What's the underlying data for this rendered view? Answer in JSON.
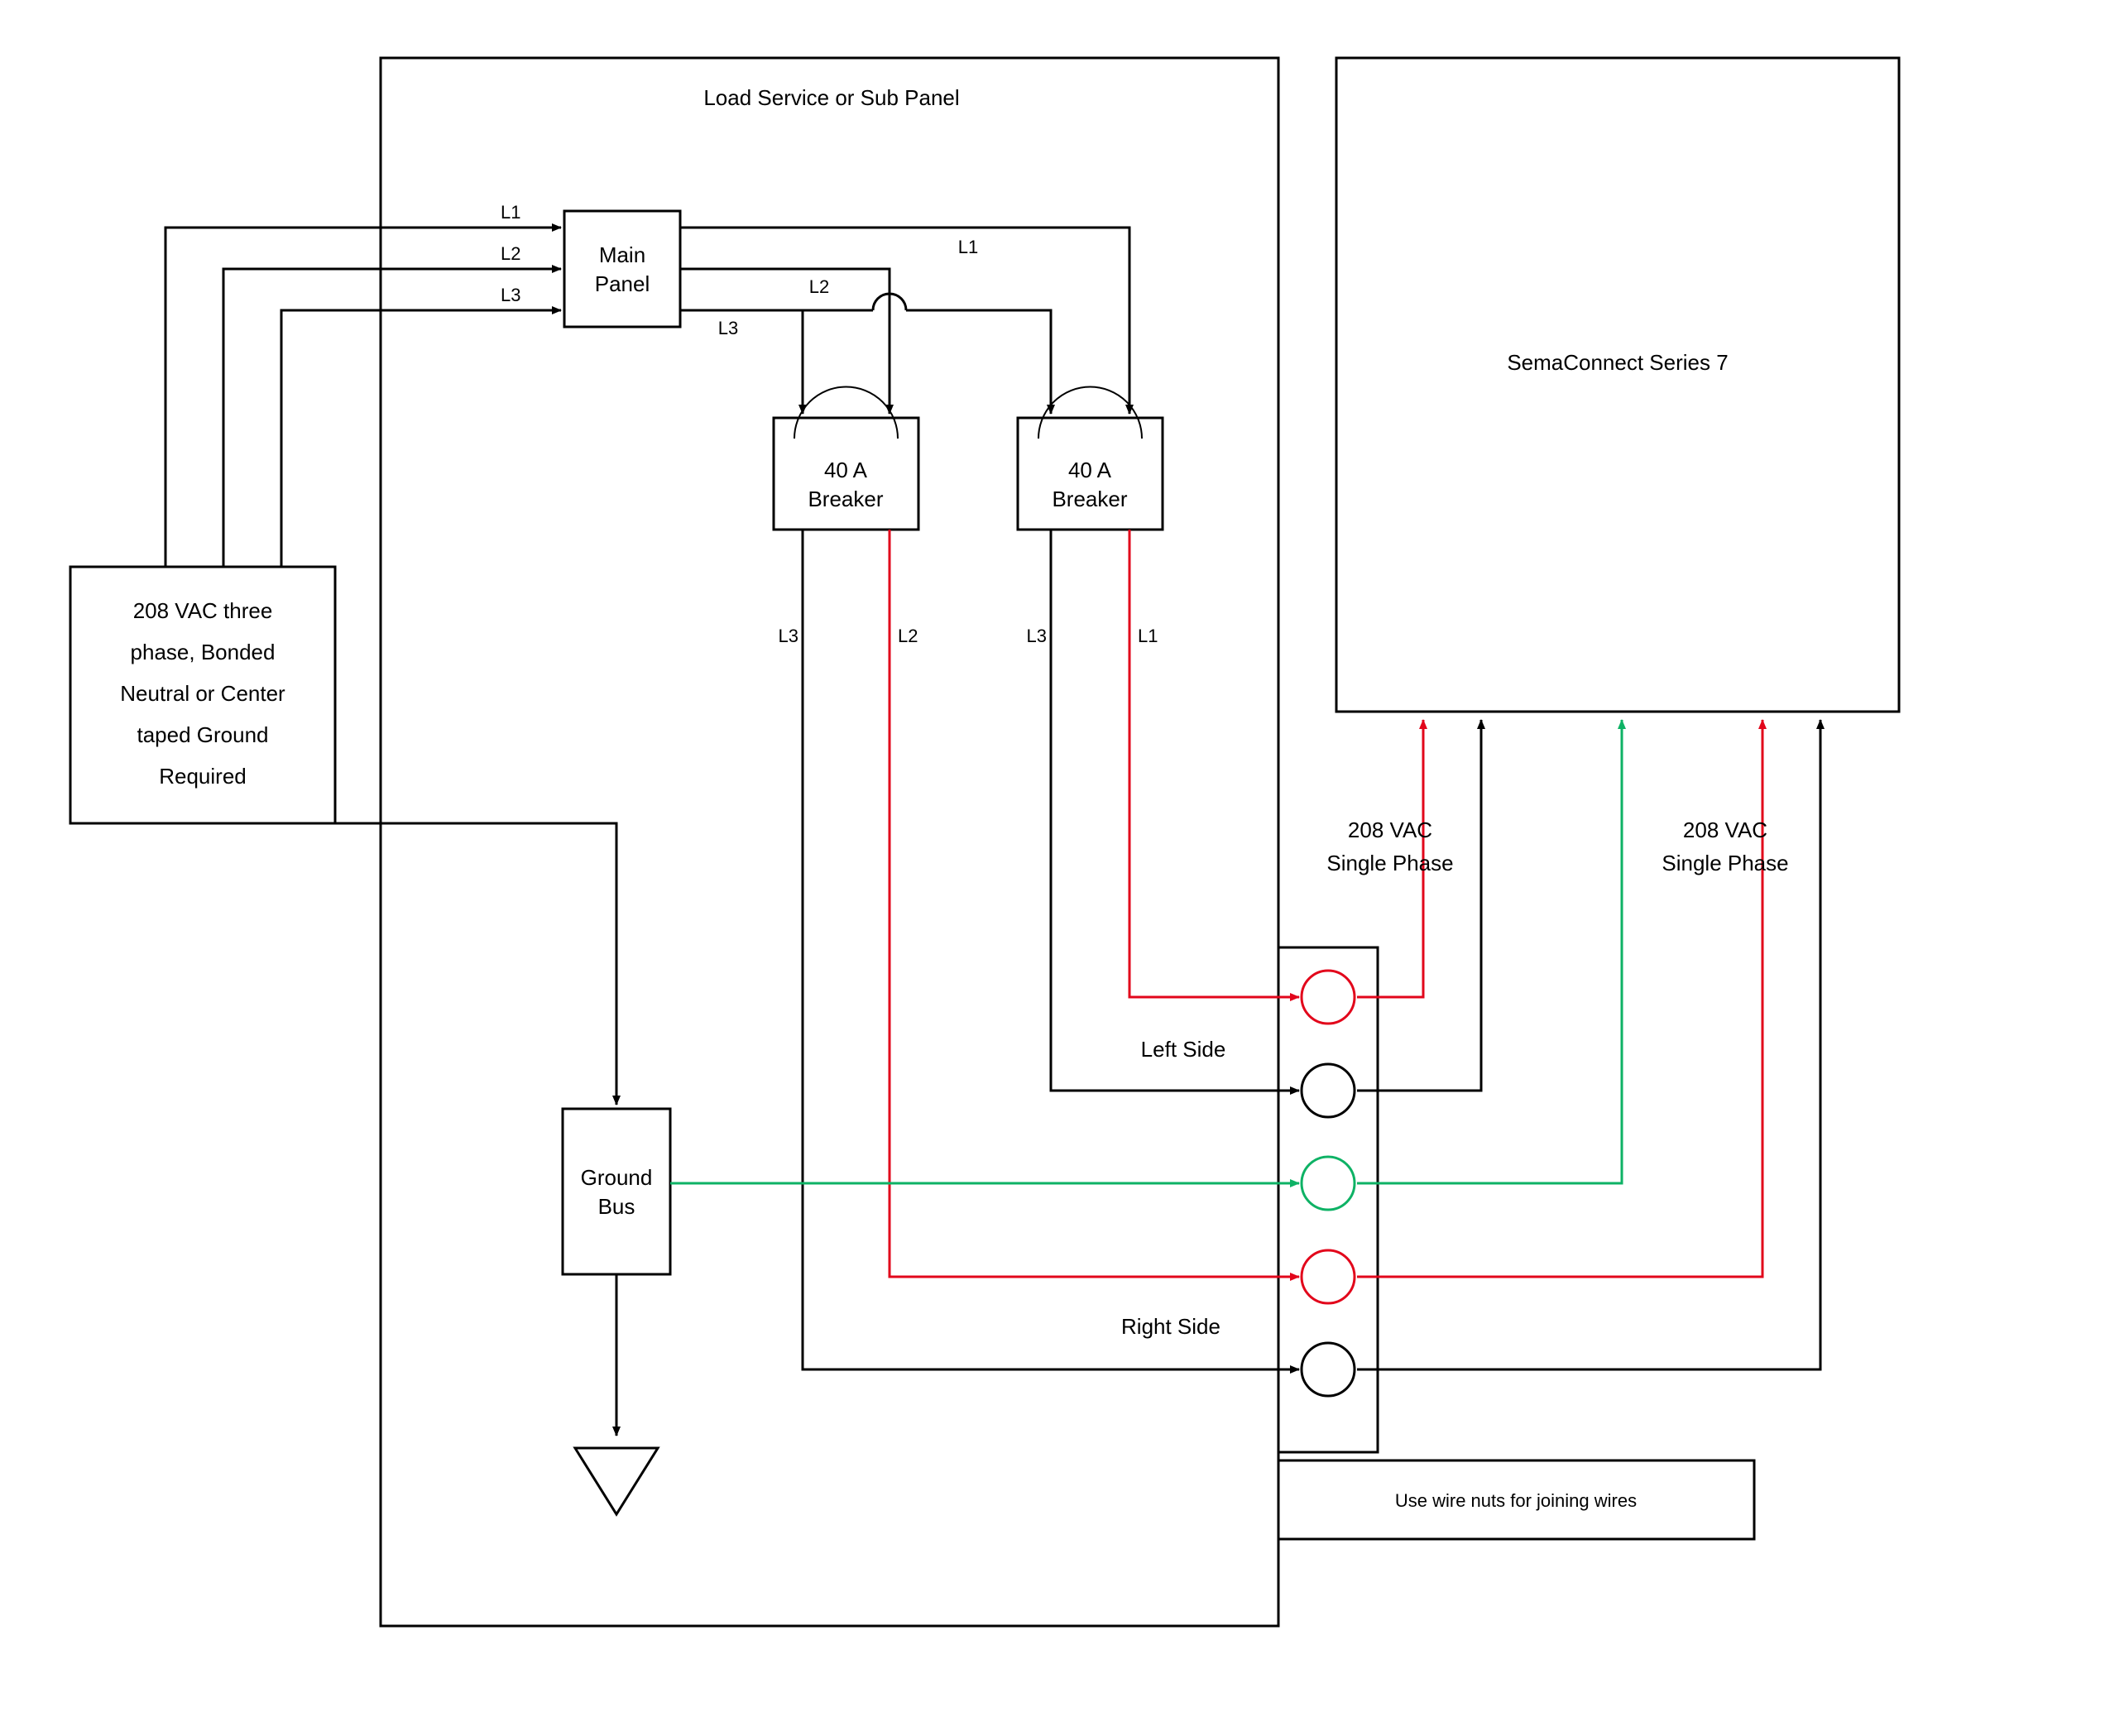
{
  "panel": {
    "title": "Load Service or Sub Panel",
    "main_panel": "Main Panel",
    "main_panel_l1": "Main",
    "main_panel_l2": "Panel"
  },
  "source": {
    "l1": "208 VAC three",
    "l2": "phase, Bonded",
    "l3": "Neutral or Center",
    "l4": "taped Ground",
    "l5": "Required"
  },
  "lines": {
    "L1": "L1",
    "L2": "L2",
    "L3": "L3"
  },
  "breaker": {
    "rating": "40 A",
    "label": "Breaker"
  },
  "ground_bus": {
    "l1": "Ground",
    "l2": "Bus"
  },
  "sides": {
    "left": "Left Side",
    "right": "Right Side"
  },
  "sema": {
    "title": "SemaConnect Series 7",
    "phase": "208 VAC",
    "phase2": "Single Phase"
  },
  "wire_nuts": "Use wire nuts for joining wires",
  "colors": {
    "black": "#000000",
    "red": "#e2061b",
    "green": "#0eb265"
  }
}
